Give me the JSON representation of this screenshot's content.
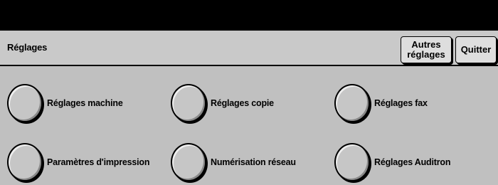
{
  "header": {
    "title": "Réglages",
    "autres_line1": "Autres",
    "autres_line2": "réglages",
    "quitter_label": "Quitter"
  },
  "options": [
    {
      "label": "Réglages machine"
    },
    {
      "label": "Réglages copie"
    },
    {
      "label": "Réglages fax"
    },
    {
      "label": "Paramètres d'impression"
    },
    {
      "label": "Numérisation réseau"
    },
    {
      "label": "Réglages Auditron"
    }
  ],
  "colors": {
    "background": "#c0c0c0",
    "top_bar": "#000000",
    "button_face": "#dedede"
  }
}
